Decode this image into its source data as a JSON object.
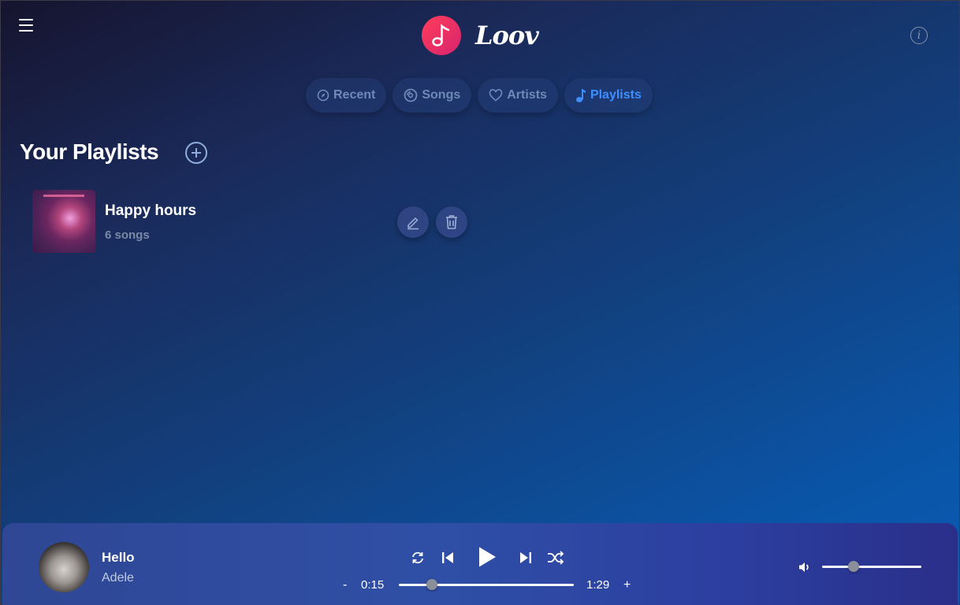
{
  "app": {
    "name": "Loov"
  },
  "header": {
    "menu_icon": "hamburger-icon",
    "info_icon": "info-icon",
    "info_glyph": "i"
  },
  "tabs": [
    {
      "label": "Recent",
      "icon": "compass-icon",
      "active": false
    },
    {
      "label": "Songs",
      "icon": "disc-icon",
      "active": false
    },
    {
      "label": "Artists",
      "icon": "heart-icon",
      "active": false
    },
    {
      "label": "Playlists",
      "icon": "music-note-icon",
      "active": true
    }
  ],
  "page": {
    "title": "Your Playlists",
    "add_icon": "plus-circle-icon"
  },
  "playlists": [
    {
      "name": "Happy hours",
      "count": "6 songs",
      "edit_icon": "pencil-icon",
      "delete_icon": "trash-icon"
    }
  ],
  "player": {
    "title": "Hello",
    "artist": "Adele",
    "current_time": "0:15",
    "duration": "1:29",
    "progress": 0.19,
    "volume": 0.32,
    "minus_label": "-",
    "plus_label": "+"
  },
  "colors": {
    "accent": "#3d8eff",
    "tab_text": "#6f8ab8",
    "logo": "#ff3d5a"
  }
}
